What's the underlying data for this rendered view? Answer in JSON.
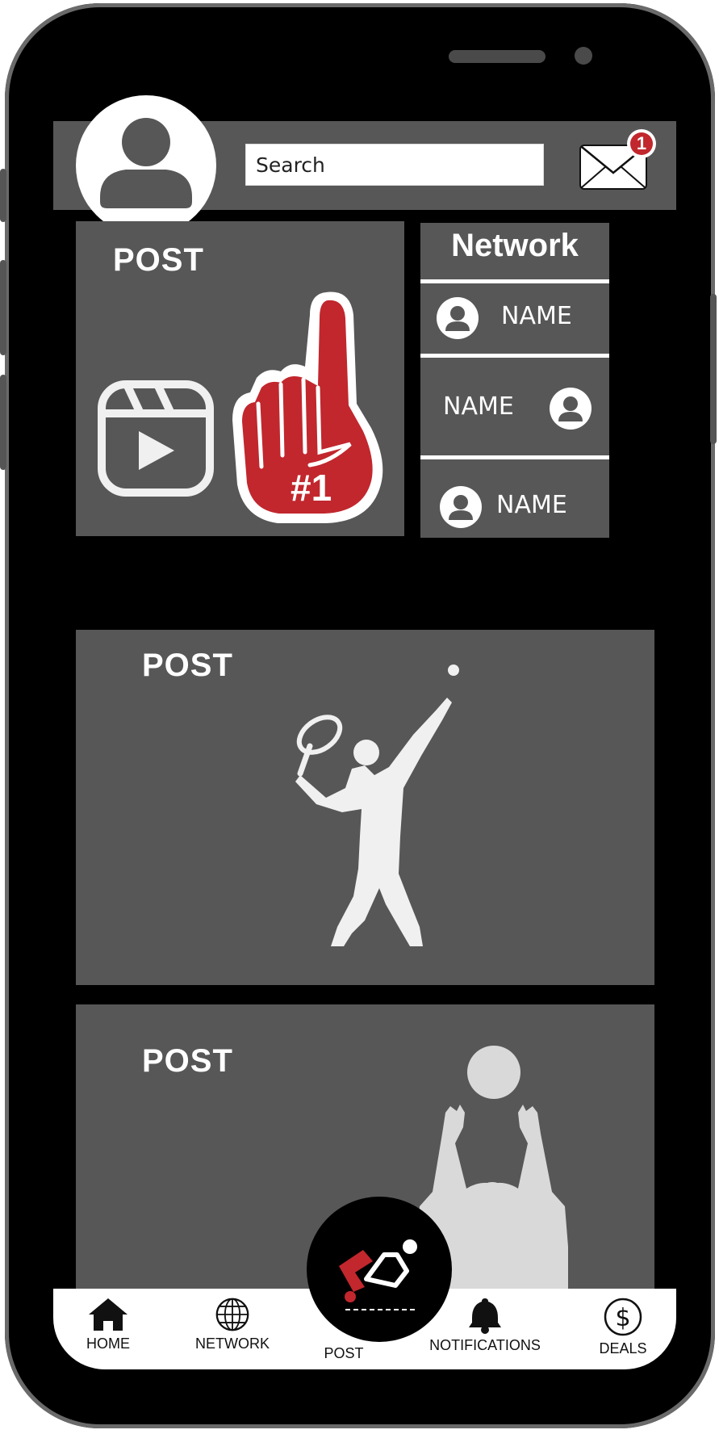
{
  "header": {
    "search_placeholder": "Search",
    "mail_badge_count": "1"
  },
  "feed": {
    "post1_title": "POST",
    "post1_badge_text": "#1",
    "post2_title": "POST",
    "post3_title": "POST"
  },
  "network": {
    "title": "Network",
    "items": [
      {
        "name": "NAME"
      },
      {
        "name": "NAME"
      },
      {
        "name": "NAME"
      }
    ]
  },
  "tabbar": {
    "home": "HOME",
    "network": "NETWORK",
    "post": "POST",
    "notifications": "NOTIFICATIONS",
    "deals": "DEALS"
  },
  "colors": {
    "screen_bg": "#000000",
    "panel": "#575757",
    "accent_red": "#c1272d",
    "text_light": "#ffffff"
  },
  "icons": {
    "avatar": "user-silhouette-icon",
    "mail": "envelope-icon",
    "reel": "video-reel-icon",
    "foam_finger": "foam-finger-icon",
    "home": "house-icon",
    "network": "globe-icon",
    "notifications": "bell-icon",
    "deals": "dollar-circle-icon"
  }
}
